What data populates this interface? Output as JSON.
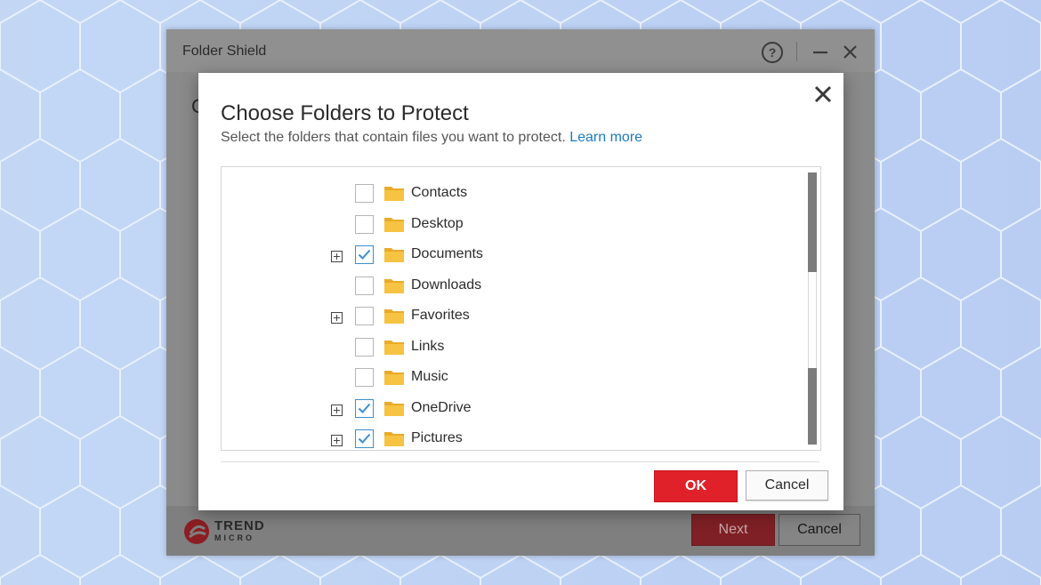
{
  "app": {
    "title": "Folder Shield",
    "body_peek": "C",
    "logo_line1": "TREND",
    "logo_line2": "MICRO",
    "next_label": "Next",
    "cancel_label": "Cancel"
  },
  "dialog": {
    "title": "Choose Folders to Protect",
    "subtitle": "Select the folders that contain files you want to protect.",
    "learn_more": "Learn more",
    "ok_label": "OK",
    "cancel_label": "Cancel",
    "folders": [
      {
        "name": "Contacts",
        "checked": false,
        "expandable": false
      },
      {
        "name": "Desktop",
        "checked": false,
        "expandable": false
      },
      {
        "name": "Documents",
        "checked": true,
        "expandable": true
      },
      {
        "name": "Downloads",
        "checked": false,
        "expandable": false
      },
      {
        "name": "Favorites",
        "checked": false,
        "expandable": true
      },
      {
        "name": "Links",
        "checked": false,
        "expandable": false
      },
      {
        "name": "Music",
        "checked": false,
        "expandable": false
      },
      {
        "name": "OneDrive",
        "checked": true,
        "expandable": true
      },
      {
        "name": "Pictures",
        "checked": true,
        "expandable": true
      }
    ]
  },
  "colors": {
    "accent_red": "#e12129",
    "link_blue": "#1a7bbf",
    "check_blue": "#3a8fd0",
    "folder_yellow": "#f6c342"
  },
  "icons": [
    "help-icon",
    "minimize-icon",
    "close-icon",
    "expander-plus-icon",
    "checkmark-icon",
    "folder-icon",
    "trend-micro-logo"
  ]
}
